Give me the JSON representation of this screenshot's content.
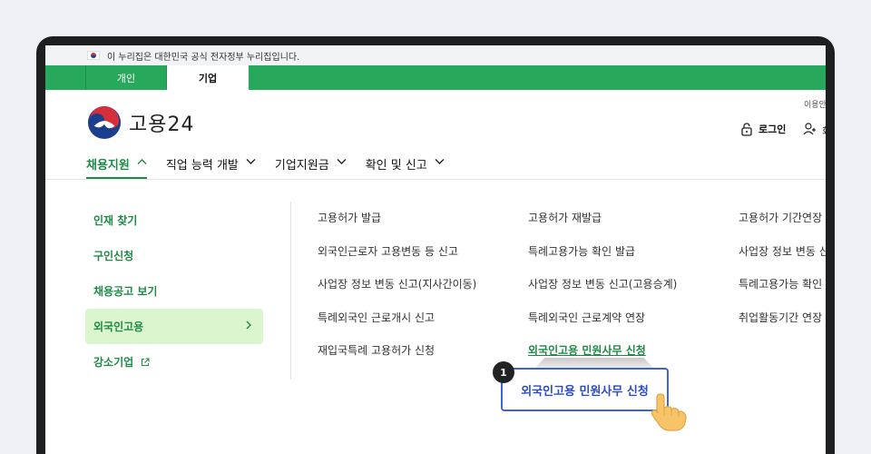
{
  "gov_notice": "이 누리집은 대한민국 공식 전자정부 누리집입니다.",
  "tabs": [
    {
      "label": "개인",
      "active": false
    },
    {
      "label": "기업",
      "active": true
    }
  ],
  "brand": {
    "name": "고용24"
  },
  "utility": {
    "top_text": "이용안",
    "login_label": "로그인",
    "join_label": "회"
  },
  "main_nav": [
    {
      "label": "채용지원",
      "active": true,
      "icon": "chevron-up-icon"
    },
    {
      "label": "직업 능력 개발",
      "active": false,
      "icon": "chevron-down-icon"
    },
    {
      "label": "기업지원금",
      "active": false,
      "icon": "chevron-down-icon"
    },
    {
      "label": "확인 및 신고",
      "active": false,
      "icon": "chevron-down-icon"
    }
  ],
  "sub_menu": [
    {
      "label": "인재 찾기",
      "active": false
    },
    {
      "label": "구인신청",
      "active": false
    },
    {
      "label": "채용공고 보기",
      "active": false
    },
    {
      "label": "외국인고용",
      "active": true
    },
    {
      "label": "강소기업",
      "active": false,
      "external": true
    }
  ],
  "links": {
    "col1": [
      "고용허가 발급",
      "외국인근로자 고용변동 등 신고",
      "사업장 정보 변동 신고(지사간이동)",
      "특례외국인 근로개시 신고",
      "재입국특례 고용허가 신청"
    ],
    "col2": [
      "고용허가 재발급",
      "특례고용가능 확인 발급",
      "사업장 정보 변동 신고(고용승계)",
      "특례외국인 근로계약 연장",
      "외국인고용 민원사무 신청"
    ],
    "col3": [
      "고용허가 기간연장",
      "사업장 정보 변동 신",
      "특례고용가능 확인",
      "취업활동기간 연장"
    ]
  },
  "callout": {
    "step": "1",
    "label": "외국인고용 민원사무 신청"
  },
  "colors": {
    "brand_green": "#27a85a",
    "link_green": "#1e8a46",
    "active_bg": "#dbf5cf",
    "callout_blue": "#3d63d6"
  }
}
